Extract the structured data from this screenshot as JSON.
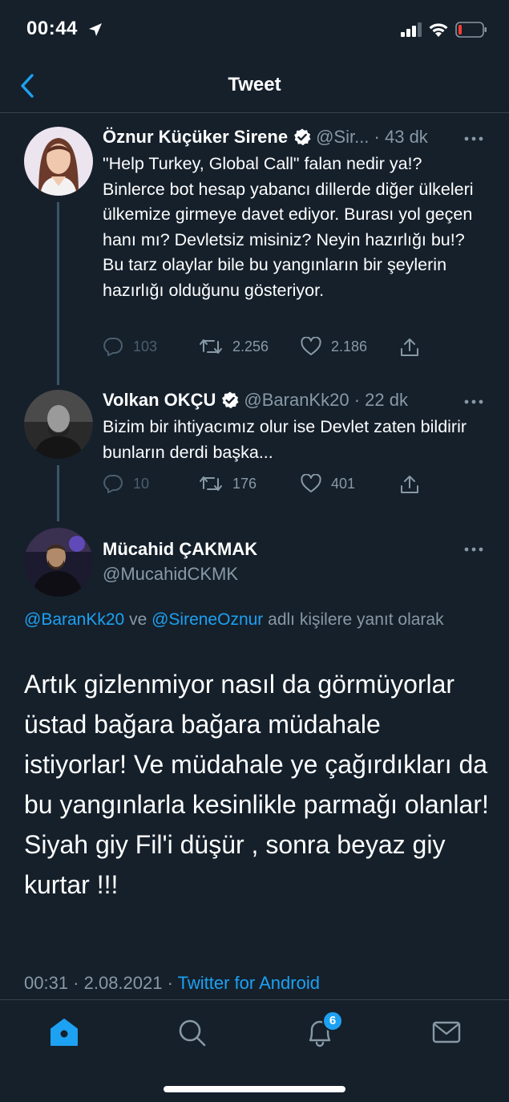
{
  "status": {
    "time": "00:44"
  },
  "nav": {
    "title": "Tweet"
  },
  "tweets": [
    {
      "name": "Öznur Küçüker Sirene",
      "handle": "@Sir...",
      "time": "43 dk",
      "text": "\"Help Turkey, Global Call\" falan nedir ya!? Binlerce bot hesap yabancı dillerde diğer ülkeleri ülkemize girmeye davet ediyor. Burası yol geçen hanı mı? Devletsiz misiniz? Neyin hazırlığı bu!? Bu tarz olaylar bile bu yangınların bir şeylerin hazırlığı olduğunu gösteriyor.",
      "replies": "103",
      "retweets": "2.256",
      "likes": "2.186"
    },
    {
      "name": "Volkan OKÇU",
      "handle": "@BaranKk20",
      "time": "22 dk",
      "text": "Bizim bir ihtiyacımız olur ise Devlet zaten bildirir bunların derdi başka...",
      "replies": "10",
      "retweets": "176",
      "likes": "401"
    }
  ],
  "main": {
    "name": "Mücahid ÇAKMAK",
    "handle": "@MucahidCKMK",
    "reply_user1": "@BaranKk20",
    "reply_and": " ve ",
    "reply_user2": "@SireneOznur",
    "reply_suffix": " adlı kişilere yanıt olarak",
    "text_line1": "Artık gizlenmiyor nasıl da görmüyorlar üstad bağara bağara müdahale istiyorlar! Ve müdahale ye çağırdıkları da bu yangınlarla kesinlikle parmağı olanlar!",
    "text_line2": "Siyah giy Fil'i düşür , sonra beyaz giy kurtar !!!",
    "timestamp": "00:31 · 2.08.2021 · ",
    "source": "Twitter for Android"
  },
  "tabbar": {
    "notif_count": "6"
  },
  "colors": {
    "background": "#15202b",
    "accent": "#1da1f2",
    "muted": "#8899a6",
    "border": "#38444d"
  }
}
